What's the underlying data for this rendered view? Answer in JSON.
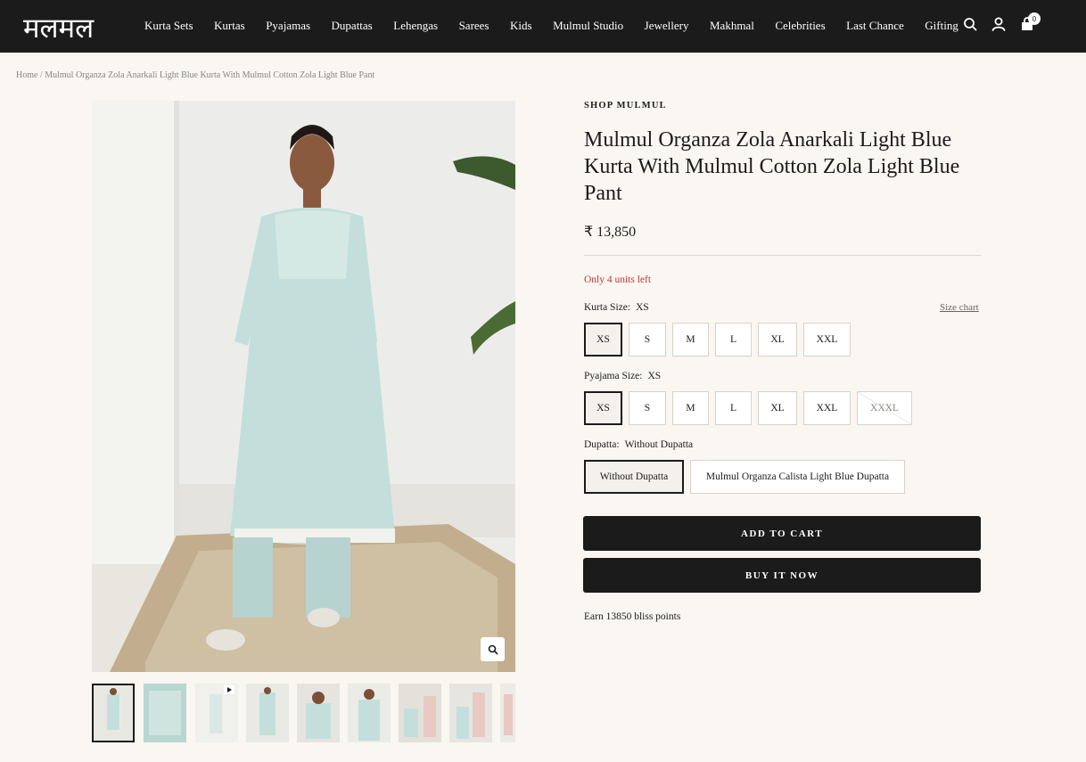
{
  "header": {
    "logo": "मलमल",
    "nav": [
      "Kurta Sets",
      "Kurtas",
      "Pyajamas",
      "Dupattas",
      "Lehengas",
      "Sarees",
      "Kids",
      "Mulmul Studio",
      "Jewellery",
      "Makhmal",
      "Celebrities",
      "Last Chance",
      "Gifting"
    ],
    "icons": [
      "search-icon",
      "account-icon",
      "cart-icon"
    ],
    "cart_count": "0"
  },
  "breadcrumb": {
    "home": "Home",
    "separator": "/",
    "current": "Mulmul Organza Zola Anarkali Light Blue Kurta With Mulmul Cotton Zola Light Blue Pant"
  },
  "product": {
    "vendor": "SHOP MULMUL",
    "title": "Mulmul Organza Zola Anarkali Light Blue Kurta With Mulmul Cotton Zola Light Blue Pant",
    "price": "₹ 13,850",
    "stock": "Only 4 units left",
    "kurta_size": {
      "label": "Kurta Size:",
      "value": "XS",
      "options": [
        "XS",
        "S",
        "M",
        "L",
        "XL",
        "XXL"
      ],
      "selected": "XS"
    },
    "size_chart": "Size chart",
    "pyajama_size": {
      "label": "Pyajama Size:",
      "value": "XS",
      "options": [
        "XS",
        "S",
        "M",
        "L",
        "XL",
        "XXL",
        "XXXL"
      ],
      "selected": "XS",
      "unavailable": [
        "XXXL"
      ]
    },
    "dupatta": {
      "label": "Dupatta:",
      "value": "Without Dupatta",
      "options": [
        "Without Dupatta",
        "Mulmul Organza Calista Light Blue Dupatta"
      ],
      "selected": "Without Dupatta"
    },
    "add_to_cart": "ADD TO CART",
    "buy_now": "BUY IT NOW",
    "bliss": "Earn 13850 bliss points"
  },
  "gallery": {
    "thumbnail_count": 9,
    "video_thumbnail_index": 2,
    "selected_index": 0
  },
  "colors": {
    "header_bg": "#1c1b1b",
    "page_bg": "#faf6f1",
    "stock_text": "#c0393b",
    "garment": "#c4dfdb"
  }
}
